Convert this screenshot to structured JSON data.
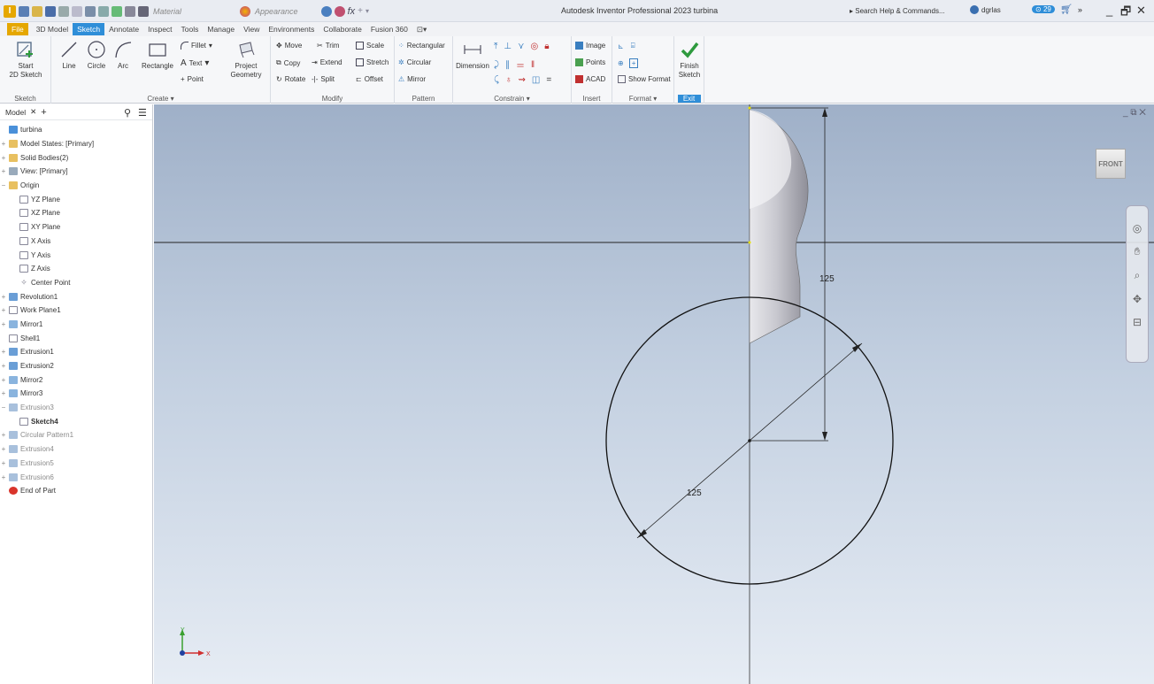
{
  "titlebar": {
    "qat_material": "Material",
    "qat_appearance": "Appearance",
    "window_title": "Autodesk Inventor Professional 2023   turbina",
    "search_placeholder": "Search Help & Commands...",
    "user": "dgrlas",
    "badge": "29"
  },
  "tabs": [
    "File",
    "3D Model",
    "Sketch",
    "Annotate",
    "Inspect",
    "Tools",
    "Manage",
    "View",
    "Environments",
    "Collaborate",
    "Fusion 360"
  ],
  "ribbon": {
    "sketch": {
      "start_label": "Start",
      "start_label2": "2D Sketch",
      "panel": "Sketch"
    },
    "create": {
      "line": "Line",
      "circle": "Circle",
      "arc": "Arc",
      "rectangle": "Rectangle",
      "fillet": "Fillet",
      "text": "Text",
      "point": "Point",
      "project1": "Project",
      "project2": "Geometry",
      "panel": "Create"
    },
    "modify": {
      "move": "Move",
      "trim": "Trim",
      "scale": "Scale",
      "copy": "Copy",
      "extend": "Extend",
      "stretch": "Stretch",
      "rotate": "Rotate",
      "split": "Split",
      "offset": "Offset",
      "panel": "Modify"
    },
    "pattern": {
      "rectangular": "Rectangular",
      "circular": "Circular",
      "mirror": "Mirror",
      "panel": "Pattern"
    },
    "constrain": {
      "dimension": "Dimension",
      "panel": "Constrain"
    },
    "insert": {
      "image": "Image",
      "points": "Points",
      "acad": "ACAD",
      "panel": "Insert"
    },
    "format": {
      "show_format": "Show Format",
      "panel": "Format"
    },
    "exit": {
      "finish1": "Finish",
      "finish2": "Sketch",
      "panel": "Exit"
    }
  },
  "browser": {
    "tab": "Model",
    "nodes": [
      {
        "label": "turbina"
      },
      {
        "label": "Model States: [Primary]"
      },
      {
        "label": "Solid Bodies(2)"
      },
      {
        "label": "View: [Primary]"
      },
      {
        "label": "Origin"
      },
      {
        "label": "YZ Plane"
      },
      {
        "label": "XZ Plane"
      },
      {
        "label": "XY Plane"
      },
      {
        "label": "X Axis"
      },
      {
        "label": "Y Axis"
      },
      {
        "label": "Z Axis"
      },
      {
        "label": "Center Point"
      },
      {
        "label": "Revolution1"
      },
      {
        "label": "Work Plane1"
      },
      {
        "label": "Mirror1"
      },
      {
        "label": "Shell1"
      },
      {
        "label": "Extrusion1"
      },
      {
        "label": "Extrusion2"
      },
      {
        "label": "Mirror2"
      },
      {
        "label": "Mirror3"
      },
      {
        "label": "Extrusion3"
      },
      {
        "label": "Sketch4"
      },
      {
        "label": "Circular Pattern1"
      },
      {
        "label": "Extrusion4"
      },
      {
        "label": "Extrusion5"
      },
      {
        "label": "Extrusion6"
      },
      {
        "label": "End of Part"
      }
    ]
  },
  "viewport": {
    "viewcube_face": "FRONT",
    "dim_vertical": "125",
    "dim_diameter": "125",
    "axis_x": "X",
    "axis_y": "Y"
  }
}
